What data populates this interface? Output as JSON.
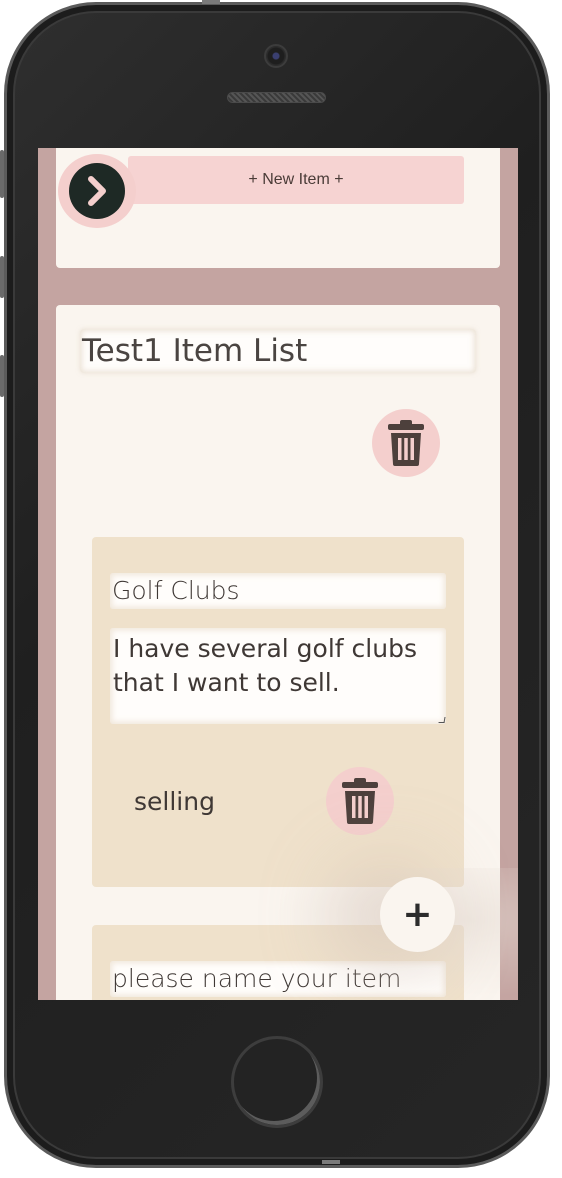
{
  "top_card": {
    "new_item_label": "+ New Item +"
  },
  "list": {
    "title": "Test1 Item List",
    "items": [
      {
        "name": "Golf Clubs",
        "description": "I have several golf clubs that I want to sell.",
        "status": "selling"
      },
      {
        "name_placeholder": "please name your item"
      }
    ]
  },
  "fab": {
    "label": "+"
  },
  "colors": {
    "screen_bg": "#c4a4a1",
    "card_bg": "#faf5ef",
    "item_bg": "#efe1cb",
    "pink_button": "#f6d3d2",
    "dark_circle": "#1e2925"
  },
  "icons": {
    "nav": "chevron-right-icon",
    "delete": "trash-icon",
    "add": "plus-icon"
  }
}
